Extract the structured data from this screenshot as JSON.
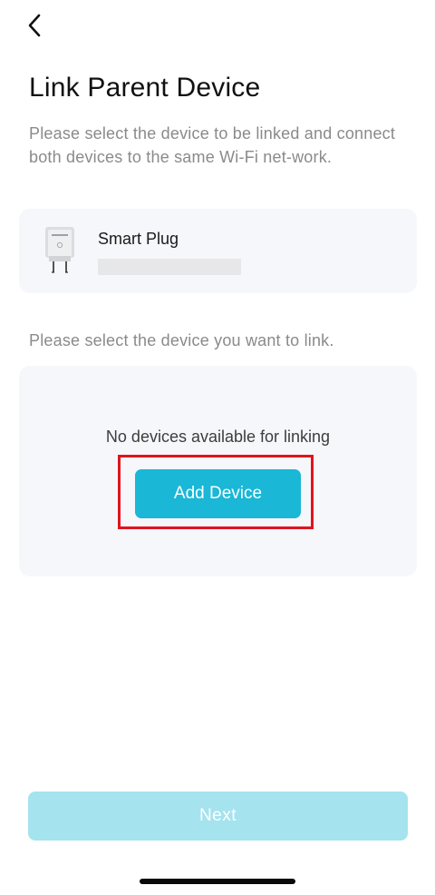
{
  "header": {
    "back_icon": "chevron-left-icon",
    "title": "Link Parent Device"
  },
  "instructions": {
    "step1": "Please select the device to be linked and connect both devices to the same Wi-Fi net-work.",
    "step2": "Please select the device you want to link."
  },
  "device_card": {
    "name": "Smart Plug",
    "thumbnail_icon": "smart-plug-icon"
  },
  "link_area": {
    "empty_message": "No devices available for linking",
    "add_device_label": "Add Device"
  },
  "footer": {
    "next_label": "Next"
  },
  "colors": {
    "accent": "#1ab7d6",
    "accent_disabled": "#a5e3ef",
    "card_background": "#f6f7fb",
    "highlight": "#e0141e"
  }
}
